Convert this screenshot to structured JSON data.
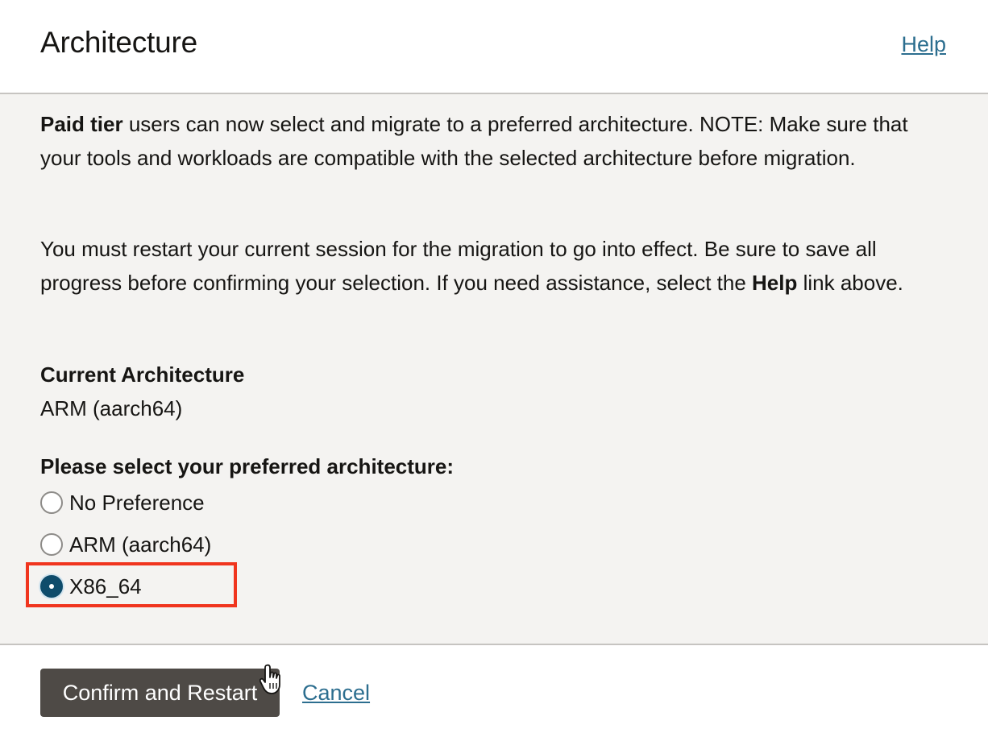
{
  "header": {
    "title": "Architecture",
    "help_label": "Help"
  },
  "body": {
    "paragraph1": {
      "bold_lead": "Paid tier",
      "text": " users can now select and migrate to a preferred architecture. NOTE: Make sure that your tools and workloads are compatible with the selected architecture before migration."
    },
    "paragraph2": {
      "text_before": "You must restart your current session for the migration to go into effect. Be sure to save all progress before confirming your selection. If you need assistance, select the ",
      "bold": "Help",
      "text_after": " link above."
    },
    "current": {
      "label": "Current Architecture",
      "value": "ARM (aarch64)"
    },
    "preference": {
      "label": "Please select your preferred architecture:",
      "options": [
        {
          "label": "No Preference",
          "selected": false
        },
        {
          "label": "ARM (aarch64)",
          "selected": false
        },
        {
          "label": "X86_64",
          "selected": true
        }
      ]
    }
  },
  "footer": {
    "confirm_label": "Confirm and Restart",
    "cancel_label": "Cancel"
  },
  "colors": {
    "accent_link": "#2c6e8f",
    "radio_selected": "#0f4c6b",
    "button_bg": "#4e4a46",
    "highlight": "#f0351e",
    "panel_bg": "#f4f3f1"
  }
}
